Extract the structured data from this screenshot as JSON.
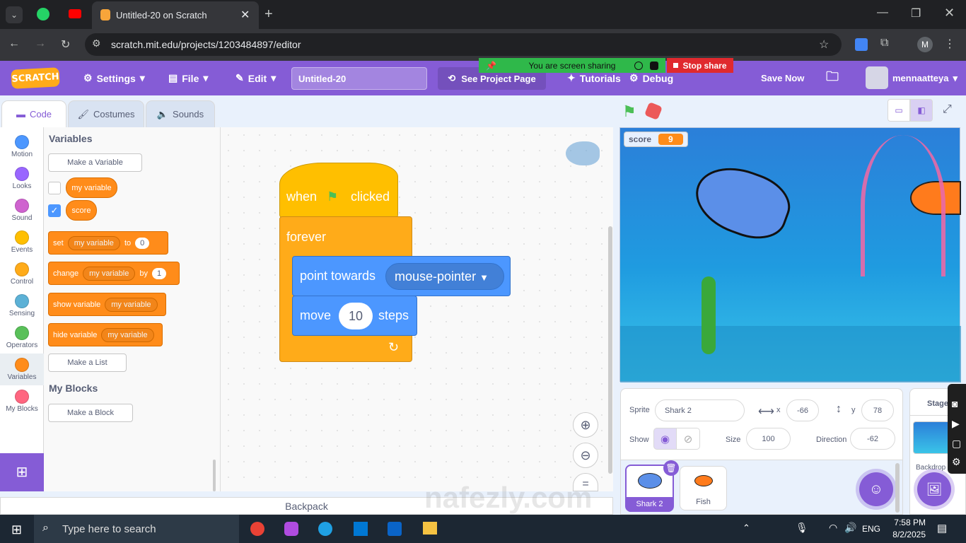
{
  "browser": {
    "tab_title": "Untitled-20 on Scratch",
    "url": "scratch.mit.edu/projects/1203484897/editor",
    "profile_initial": "M"
  },
  "screen_share": {
    "message": "You are screen sharing",
    "stop_label": "Stop share"
  },
  "menu": {
    "logo": "SCRATCH",
    "settings": "Settings",
    "file": "File",
    "edit": "Edit",
    "project_title": "Untitled-20",
    "see_project_page": "See Project Page",
    "tutorials": "Tutorials",
    "debug": "Debug",
    "save_now": "Save Now",
    "username": "mennaatteya"
  },
  "tabs": {
    "code": "Code",
    "costumes": "Costumes",
    "sounds": "Sounds"
  },
  "categories": [
    {
      "label": "Motion",
      "color": "#4c97ff"
    },
    {
      "label": "Looks",
      "color": "#9966ff"
    },
    {
      "label": "Sound",
      "color": "#cf63cf"
    },
    {
      "label": "Events",
      "color": "#ffbf00"
    },
    {
      "label": "Control",
      "color": "#ffab19"
    },
    {
      "label": "Sensing",
      "color": "#5cb1d6"
    },
    {
      "label": "Operators",
      "color": "#59c059"
    },
    {
      "label": "Variables",
      "color": "#ff8c1a"
    },
    {
      "label": "My Blocks",
      "color": "#ff6680"
    }
  ],
  "palette": {
    "variables_heading": "Variables",
    "make_variable": "Make a Variable",
    "var1": "my variable",
    "var2": "score",
    "set": "set",
    "set_var": "my variable",
    "to": "to",
    "set_val": "0",
    "change": "change",
    "change_var": "my variable",
    "by": "by",
    "change_val": "1",
    "show_variable": "show variable",
    "show_var": "my variable",
    "hide_variable": "hide variable",
    "hide_var": "my variable",
    "make_list": "Make a List",
    "myblocks_heading": "My Blocks",
    "make_block": "Make a Block"
  },
  "script": {
    "when": "when",
    "clicked": "clicked",
    "forever": "forever",
    "point_towards": "point towards",
    "target": "mouse-pointer",
    "move": "move",
    "steps_val": "10",
    "steps": "steps"
  },
  "backpack": "Backpack",
  "stage": {
    "monitor_label": "score",
    "monitor_value": "9"
  },
  "sprite_info": {
    "sprite_label": "Sprite",
    "sprite_name": "Shark 2",
    "x_label": "x",
    "x": "-66",
    "y_label": "y",
    "y": "78",
    "show_label": "Show",
    "size_label": "Size",
    "size": "100",
    "direction_label": "Direction",
    "direction": "-62"
  },
  "sprites": [
    {
      "name": "Shark 2"
    },
    {
      "name": "Fish"
    }
  ],
  "stage_panel": {
    "label": "Stage",
    "backdrops": "Backdrop"
  },
  "watermark": "nafezly.com",
  "taskbar": {
    "search": "Type here to search",
    "lang": "ENG",
    "time": "7:58 PM",
    "date": "8/2/2025"
  },
  "colors": {
    "scratch_purple": "#855cd6",
    "variables_orange": "#ff8c1a",
    "control_gold": "#ffab19",
    "motion_blue": "#4c97ff",
    "events_yellow": "#ffbf00"
  }
}
